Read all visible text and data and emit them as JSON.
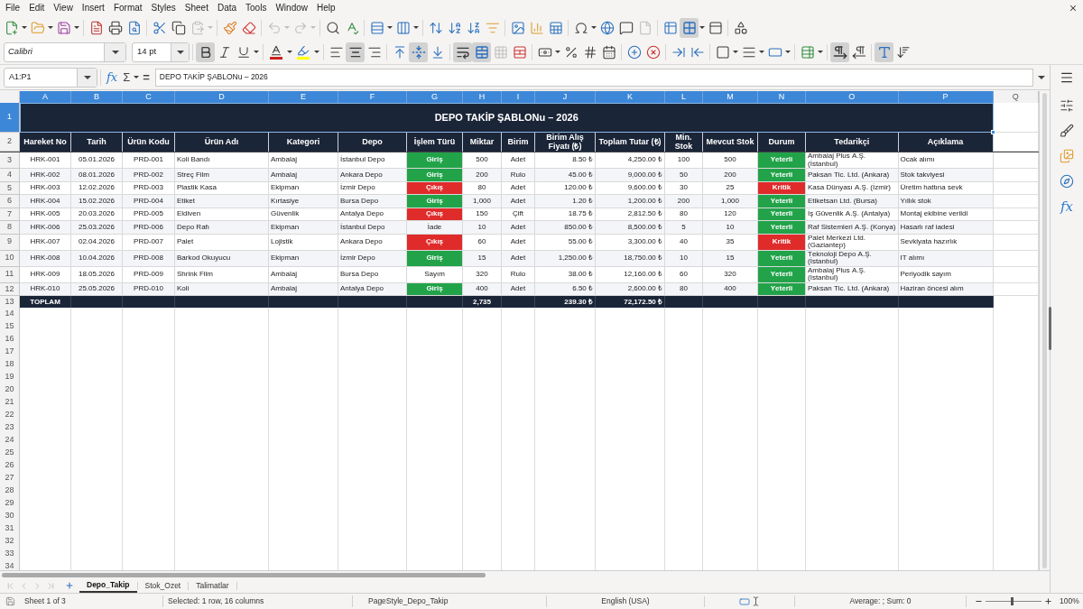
{
  "menu_bar": [
    "File",
    "Edit",
    "View",
    "Insert",
    "Format",
    "Styles",
    "Sheet",
    "Data",
    "Tools",
    "Window",
    "Help"
  ],
  "standard_toolbar": {
    "paste_disabled": true,
    "undo_disabled": true,
    "redo_disabled": true,
    "headers_footers_disabled": true,
    "freeze_panes": true
  },
  "formatting_toolbar": {
    "font_name": "Calibri",
    "font_size": "14 pt",
    "bold": true,
    "italic": false,
    "underline": false,
    "align_left": false,
    "align_center": true,
    "align_right": false,
    "align_top": false,
    "align_middle": true,
    "align_bottom": false,
    "wrap_text": true,
    "merge_center": true,
    "merge_cells_disabled": true,
    "left_to_right": true,
    "right_to_left": false,
    "text_horizontal": true,
    "text_vertical": false
  },
  "formula_bar": {
    "name_box": "A1:P1",
    "function_wizard": "fx",
    "sum": "Σ",
    "equals": "=",
    "formula": "DEPO TAKİP ŞABLONu – 2026"
  },
  "sheet": {
    "columns": [
      {
        "label": "A",
        "selected": true
      },
      {
        "label": "B",
        "selected": true
      },
      {
        "label": "C",
        "selected": true
      },
      {
        "label": "D",
        "selected": true
      },
      {
        "label": "E",
        "selected": true
      },
      {
        "label": "F",
        "selected": true
      },
      {
        "label": "G",
        "selected": true
      },
      {
        "label": "H",
        "selected": true
      },
      {
        "label": "I",
        "selected": true
      },
      {
        "label": "J",
        "selected": true
      },
      {
        "label": "K",
        "selected": true
      },
      {
        "label": "L",
        "selected": true
      },
      {
        "label": "M",
        "selected": true
      },
      {
        "label": "N",
        "selected": true
      },
      {
        "label": "O",
        "selected": true
      },
      {
        "label": "P",
        "selected": true
      },
      {
        "label": "Q",
        "selected": false
      }
    ],
    "row_numbers": [
      {
        "label": "1",
        "selected": true
      },
      {
        "label": "2",
        "selected": false
      },
      {
        "label": "3",
        "selected": false
      },
      {
        "label": "4",
        "selected": false
      },
      {
        "label": "5",
        "selected": false
      },
      {
        "label": "6",
        "selected": false
      },
      {
        "label": "7",
        "selected": false
      },
      {
        "label": "8",
        "selected": false
      },
      {
        "label": "9",
        "selected": false
      },
      {
        "label": "10",
        "selected": false
      },
      {
        "label": "11",
        "selected": false
      },
      {
        "label": "12",
        "selected": false
      },
      {
        "label": "13",
        "selected": false
      },
      {
        "label": "14",
        "selected": false
      },
      {
        "label": "15",
        "selected": false
      },
      {
        "label": "16",
        "selected": false
      },
      {
        "label": "17",
        "selected": false
      },
      {
        "label": "18",
        "selected": false
      },
      {
        "label": "19",
        "selected": false
      },
      {
        "label": "20",
        "selected": false
      },
      {
        "label": "21",
        "selected": false
      },
      {
        "label": "22",
        "selected": false
      },
      {
        "label": "23",
        "selected": false
      },
      {
        "label": "24",
        "selected": false
      },
      {
        "label": "25",
        "selected": false
      },
      {
        "label": "26",
        "selected": false
      },
      {
        "label": "27",
        "selected": false
      },
      {
        "label": "28",
        "selected": false
      },
      {
        "label": "29",
        "selected": false
      },
      {
        "label": "30",
        "selected": false
      },
      {
        "label": "31",
        "selected": false
      },
      {
        "label": "32",
        "selected": false
      },
      {
        "label": "33",
        "selected": false
      },
      {
        "label": "34",
        "selected": false
      }
    ],
    "title": "DEPO TAKİP ŞABLONu – 2026",
    "header": [
      "Hareket No",
      "Tarih",
      "Ürün Kodu",
      "Ürün Adı",
      "Kategori",
      "Depo",
      "İşlem Türü",
      "Miktar",
      "Birim",
      "Birim Alış Fiyatı (₺)",
      "Toplam Tutar (₺)",
      "Min. Stok",
      "Mevcut Stok",
      "Durum",
      "Tedarikçi",
      "Açıklama"
    ],
    "rows": [
      {
        "cells": [
          "HRK-001",
          "05.01.2026",
          "PRD-001",
          "Koli Bandı",
          "Ambalaj",
          "İstanbul Depo",
          {
            "text": "Giriş",
            "color": "#22a34a"
          },
          "500",
          "Adet",
          "8.50 ₺",
          "4,250.00 ₺",
          "100",
          "500",
          {
            "text": "Yeterli",
            "color": "#22a34a"
          },
          "Ambalaj Plus A.Ş. (İstanbul)",
          "Ocak alımı"
        ]
      },
      {
        "cells": [
          "HRK-002",
          "08.01.2026",
          "PRD-002",
          "Streç Film",
          "Ambalaj",
          "Ankara Depo",
          {
            "text": "Giriş",
            "color": "#22a34a"
          },
          "200",
          "Rulo",
          "45.00 ₺",
          "9,000.00 ₺",
          "50",
          "200",
          {
            "text": "Yeterli",
            "color": "#22a34a"
          },
          "Paksan Tic. Ltd. (Ankara)",
          "Stok takviyesi"
        ]
      },
      {
        "cells": [
          "HRK-003",
          "12.02.2026",
          "PRD-003",
          "Plastik Kasa",
          "Ekipman",
          "İzmir Depo",
          {
            "text": "Çıkış",
            "color": "#e02b2b"
          },
          "80",
          "Adet",
          "120.00 ₺",
          "9,600.00 ₺",
          "30",
          "25",
          {
            "text": "Kritik",
            "color": "#e02b2b"
          },
          "Kasa Dünyası A.Ş. (İzmir)",
          "Üretim hattına sevk"
        ]
      },
      {
        "cells": [
          "HRK-004",
          "15.02.2026",
          "PRD-004",
          "Etiket",
          "Kırtasiye",
          "Bursa Depo",
          {
            "text": "Giriş",
            "color": "#22a34a"
          },
          "1,000",
          "Adet",
          "1.20 ₺",
          "1,200.00 ₺",
          "200",
          "1,000",
          {
            "text": "Yeterli",
            "color": "#22a34a"
          },
          "Etiketsan Ltd. (Bursa)",
          "Yıllık stok"
        ]
      },
      {
        "cells": [
          "HRK-005",
          "20.03.2026",
          "PRD-005",
          "Eldiven",
          "Güvenlik",
          "Antalya Depo",
          {
            "text": "Çıkış",
            "color": "#e02b2b"
          },
          "150",
          "Çift",
          "18.75 ₺",
          "2,812.50 ₺",
          "80",
          "120",
          {
            "text": "Yeterli",
            "color": "#22a34a"
          },
          "İş Güvenlik A.Ş. (Antalya)",
          "Montaj ekibine verildi"
        ]
      },
      {
        "cells": [
          "HRK-006",
          "25.03.2026",
          "PRD-006",
          "Depo Rafı",
          "Ekipman",
          "İstanbul Depo",
          {
            "text": "İade"
          },
          "10",
          "Adet",
          "850.00 ₺",
          "8,500.00 ₺",
          "5",
          "10",
          {
            "text": "Yeterli",
            "color": "#22a34a"
          },
          "Raf Sistemleri A.Ş. (Konya)",
          "Hasarlı raf iadesi"
        ]
      },
      {
        "cells": [
          "HRK-007",
          "02.04.2026",
          "PRD-007",
          "Palet",
          "Lojistik",
          "Ankara Depo",
          {
            "text": "Çıkış",
            "color": "#e02b2b"
          },
          "60",
          "Adet",
          "55.00 ₺",
          "3,300.00 ₺",
          "40",
          "35",
          {
            "text": "Kritik",
            "color": "#e02b2b"
          },
          "Palet Merkezi Ltd. (Gaziantep)",
          "Sevkiyata hazırlık"
        ]
      },
      {
        "cells": [
          "HRK-008",
          "10.04.2026",
          "PRD-008",
          "Barkod Okuyucu",
          "Ekipman",
          "İzmir Depo",
          {
            "text": "Giriş",
            "color": "#22a34a"
          },
          "15",
          "Adet",
          "1,250.00 ₺",
          "18,750.00 ₺",
          "10",
          "15",
          {
            "text": "Yeterli",
            "color": "#22a34a"
          },
          "Teknoloji Depo A.Ş. (İstanbul)",
          "IT alımı"
        ]
      },
      {
        "cells": [
          "HRK-009",
          "18.05.2026",
          "PRD-009",
          "Shrink Film",
          "Ambalaj",
          "Bursa Depo",
          {
            "text": "Sayım"
          },
          "320",
          "Rulo",
          "38.00 ₺",
          "12,160.00 ₺",
          "60",
          "320",
          {
            "text": "Yeterli",
            "color": "#22a34a"
          },
          "Ambalaj Plus A.Ş. (İstanbul)",
          "Periyodik sayım"
        ]
      },
      {
        "cells": [
          "HRK-010",
          "25.05.2026",
          "PRD-010",
          "Koli",
          "Ambalaj",
          "Antalya Depo",
          {
            "text": "Giriş",
            "color": "#22a34a"
          },
          "400",
          "Adet",
          "6.50 ₺",
          "2,600.00 ₺",
          "80",
          "400",
          {
            "text": "Yeterli",
            "color": "#22a34a"
          },
          "Paksan Tic. Ltd. (Ankara)",
          "Haziran öncesi alım"
        ]
      }
    ],
    "total_row": {
      "label": "TOPLAM",
      "quantity": "2,735",
      "unit_price": "239.30 ₺",
      "total": "72,172.50 ₺"
    }
  },
  "sheet_tabs": {
    "navigation_disabled": true,
    "tabs": [
      {
        "label": "Depo_Takip",
        "selected": true
      },
      {
        "label": "Stok_Ozet",
        "selected": false
      },
      {
        "label": "Talimatlar",
        "selected": false
      }
    ]
  },
  "sidebar": {
    "functions": "fx"
  },
  "status_bar": {
    "sheet": "Sheet 1 of 3",
    "selection": "Selected: 1 row, 16 columns",
    "page_style": "PageStyle_Depo_Takip",
    "language": "English (USA)",
    "summary": "Average: ; Sum: 0",
    "zoom_slider": {
      "level": 0.48
    },
    "zoom": "100%"
  }
}
